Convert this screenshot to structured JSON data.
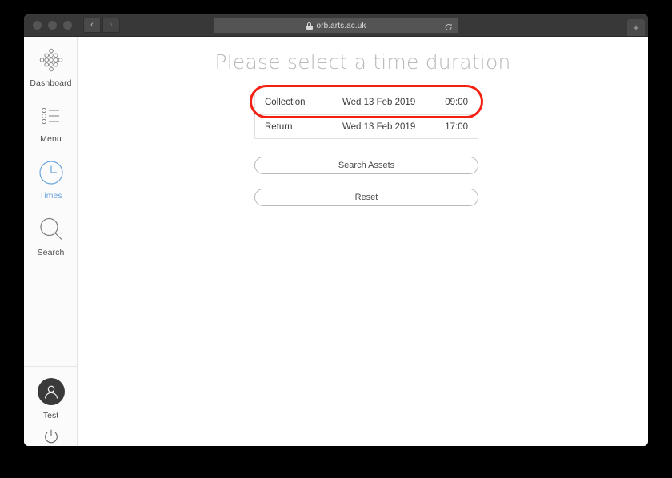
{
  "browser": {
    "traffic_lights": [
      "close",
      "minimize",
      "zoom"
    ],
    "back_label": "‹",
    "forward_label": "›",
    "url": "orb.arts.ac.uk",
    "lock_icon": "lock-icon",
    "reload_icon": "reload-icon",
    "new_tab_label": "+"
  },
  "sidebar": {
    "items": [
      {
        "label": "Dashboard",
        "icon": "dashboard-icon",
        "active": false
      },
      {
        "label": "Menu",
        "icon": "menu-list-icon",
        "active": false
      },
      {
        "label": "Times",
        "icon": "clock-icon",
        "active": true
      },
      {
        "label": "Search",
        "icon": "search-icon",
        "active": false
      }
    ],
    "user": {
      "name": "Test",
      "avatar_icon": "user-avatar-icon",
      "power_icon": "power-icon"
    },
    "active_color": "#6ba5dd"
  },
  "main": {
    "title": "Please select a time duration",
    "duration_rows": [
      {
        "label": "Collection",
        "date": "Wed 13 Feb 2019",
        "time": "09:00",
        "highlighted": true
      },
      {
        "label": "Return",
        "date": "Wed 13 Feb 2019",
        "time": "17:00",
        "highlighted": false
      }
    ],
    "buttons": [
      {
        "label": "Search Assets",
        "name": "search-assets-button"
      },
      {
        "label": "Reset",
        "name": "reset-button"
      }
    ],
    "annotation": {
      "shape": "ellipse",
      "color": "#f42011",
      "target": "Collection"
    }
  }
}
